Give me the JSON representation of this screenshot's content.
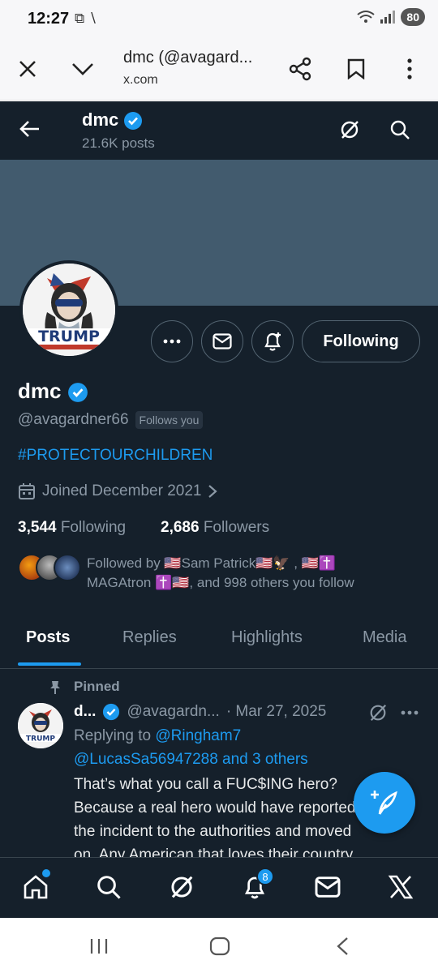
{
  "status_bar": {
    "time": "12:27",
    "battery": "80"
  },
  "browser": {
    "title": "dmc (@avagard...",
    "url": "x.com"
  },
  "header": {
    "name": "dmc",
    "posts_count": "21.6K posts"
  },
  "profile": {
    "avatar_text": "TRUMP",
    "display_name": "dmc",
    "handle": "@avagardner66",
    "follows_you_badge": "Follows you",
    "bio": "#PROTECTOURCHILDREN",
    "joined": "Joined December 2021",
    "following_count": "3,544",
    "following_label": "Following",
    "followers_count": "2,686",
    "followers_label": "Followers",
    "followed_by_line1": "Followed by 🇺🇸Sam Patrick🇺🇸🦅 , 🇺🇸✝️",
    "followed_by_line2": "MAGAtron ✝️🇺🇸, and 998 others you follow",
    "following_button": "Following"
  },
  "tabs": [
    {
      "label": "Posts",
      "active": true
    },
    {
      "label": "Replies",
      "active": false
    },
    {
      "label": "Highlights",
      "active": false
    },
    {
      "label": "Media",
      "active": false
    }
  ],
  "pinned_post": {
    "pinned_label": "Pinned",
    "author": "d...",
    "handle": "@avagardn...",
    "date": "· Mar 27, 2025",
    "replying_to_label": "Replying to",
    "replying_to_user": "@Ringham7",
    "replying_line2": "@LucasSa56947288 and 3 others",
    "text_lines": [
      "That’s what you call a FUC$ING hero?",
      "Because a real hero would have reported",
      "the incident to the authorities and moved",
      "on. Any American that loves their country"
    ]
  },
  "bottom_nav": {
    "notifications_badge": "8"
  },
  "colors": {
    "background": "#15202b",
    "accent": "#1d9bf0",
    "banner": "#425b6e",
    "muted": "#8b98a5"
  }
}
